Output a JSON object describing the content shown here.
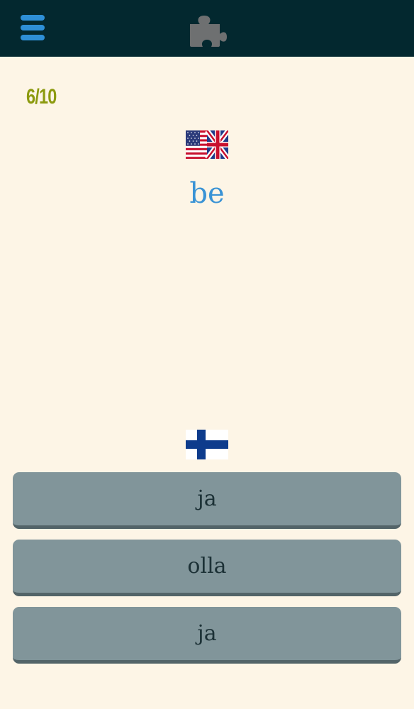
{
  "header": {
    "menu_icon": "hamburger-menu-icon",
    "puzzle_icon": "puzzle-piece-icon",
    "bar_color": "#03282f",
    "menu_color": "#2e8fd6"
  },
  "quiz": {
    "progress": "6/10",
    "source_language_flag": "us-uk-flag",
    "target_language_flag": "finland-flag",
    "word": "be",
    "answers": [
      "ja",
      "olla",
      "ja"
    ]
  },
  "colors": {
    "background": "#fdf5e6",
    "progress": "#8c9a0f",
    "word": "#3a93d5",
    "answer_button": "#81959a",
    "answer_text": "#1c3136"
  }
}
